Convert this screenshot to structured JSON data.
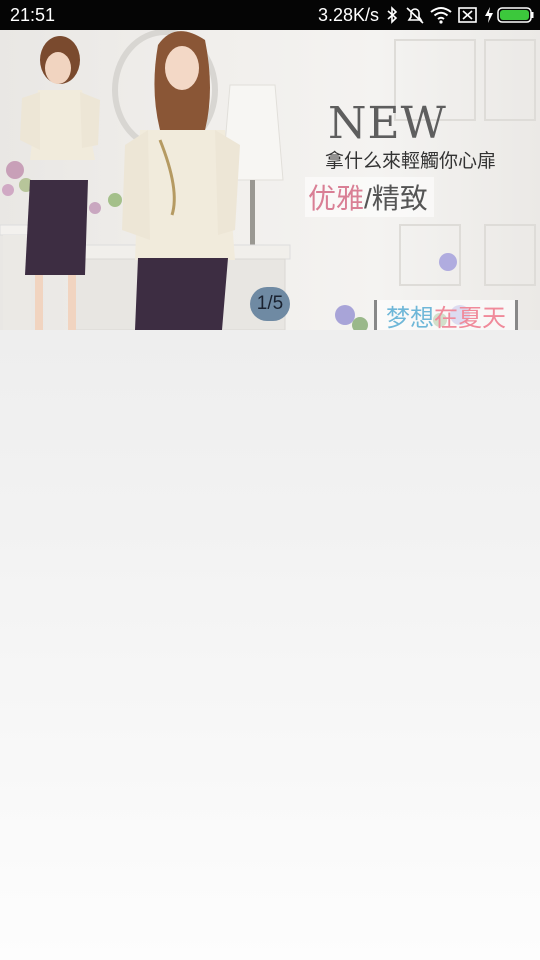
{
  "status_bar": {
    "time": "21:51",
    "network_speed": "3.28K/s",
    "icons": [
      "bluetooth-icon",
      "alarm-off-icon",
      "wifi-icon",
      "sim-disabled-icon",
      "charging-icon",
      "battery-icon"
    ],
    "battery_color": "#3cc83c"
  },
  "banner": {
    "headline": "NEW",
    "subtitle": "拿什么來輕觸你心扉",
    "tag_elegant": "优雅",
    "tag_separator": "/",
    "tag_refined": "精致",
    "dream_part1": "梦想",
    "dream_part2": "在夏天绽放",
    "page_indicator": "1/5"
  }
}
